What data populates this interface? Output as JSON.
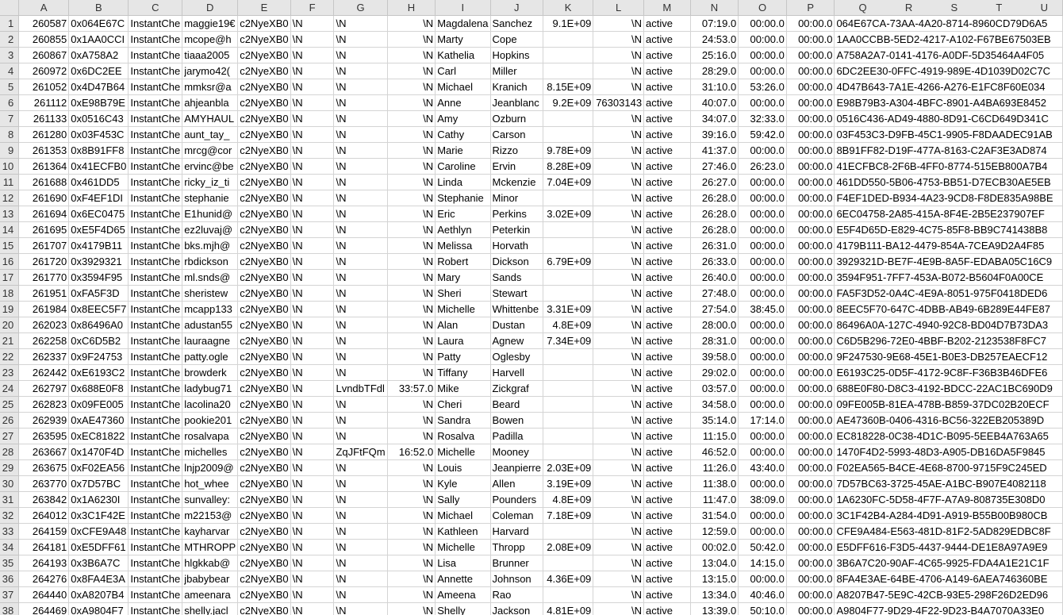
{
  "columns": [
    "A",
    "B",
    "C",
    "D",
    "E",
    "F",
    "G",
    "H",
    "I",
    "J",
    "K",
    "L",
    "M",
    "N",
    "O",
    "P",
    "Q",
    "R",
    "S",
    "T",
    "U"
  ],
  "rows": [
    [
      "260587",
      "0x064E67C",
      "InstantChe",
      "maggie19€",
      "c2NyeXB0",
      "\\N",
      "\\N",
      "\\N",
      "Magdalena",
      "Sanchez",
      "9.1E+09",
      "\\N",
      "active",
      "07:19.0",
      "00:00.0",
      "00:00.0",
      "064E67CA-73AA-4A20-8714-8960CD79D6A5"
    ],
    [
      "260855",
      "0x1AA0CCI",
      "InstantChe",
      "mcope@h",
      "c2NyeXB0",
      "\\N",
      "\\N",
      "\\N",
      "Marty",
      "Cope",
      "",
      "\\N",
      "active",
      "24:53.0",
      "00:00.0",
      "00:00.0",
      "1AA0CCBB-5ED2-4217-A102-F67BE67503EB"
    ],
    [
      "260867",
      "0xA758A2",
      "InstantChe",
      "tiaaa2005",
      "c2NyeXB0",
      "\\N",
      "\\N",
      "\\N",
      "Kathelia",
      "Hopkins",
      "",
      "\\N",
      "active",
      "25:16.0",
      "00:00.0",
      "00:00.0",
      "A758A2A7-0141-4176-A0DF-5D35464A4F05"
    ],
    [
      "260972",
      "0x6DC2EE",
      "InstantChe",
      "jarymo42(",
      "c2NyeXB0",
      "\\N",
      "\\N",
      "\\N",
      "Carl",
      "Miller",
      "",
      "\\N",
      "active",
      "28:29.0",
      "00:00.0",
      "00:00.0",
      "6DC2EE30-0FFC-4919-989E-4D1039D02C7C"
    ],
    [
      "261052",
      "0x4D47B64",
      "InstantChe",
      "mmksr@a",
      "c2NyeXB0",
      "\\N",
      "\\N",
      "\\N",
      "Michael",
      "Kranich",
      "8.15E+09",
      "\\N",
      "active",
      "31:10.0",
      "53:26.0",
      "00:00.0",
      "4D47B643-7A1E-4266-A276-E1FC8F60E034"
    ],
    [
      "261112",
      "0xE98B79E",
      "InstantChe",
      "ahjeanbla",
      "c2NyeXB0",
      "\\N",
      "\\N",
      "\\N",
      "Anne",
      "Jeanblanc",
      "9.2E+09",
      "76303143",
      "active",
      "40:07.0",
      "00:00.0",
      "00:00.0",
      "E98B79B3-A304-4BFC-8901-A4BA693E8452"
    ],
    [
      "261133",
      "0x0516C43",
      "InstantChe",
      "AMYHAUL",
      "c2NyeXB0",
      "\\N",
      "\\N",
      "\\N",
      "Amy",
      "Ozburn",
      "",
      "\\N",
      "active",
      "34:07.0",
      "32:33.0",
      "00:00.0",
      "0516C436-AD49-4880-8D91-C6CD649D341C"
    ],
    [
      "261280",
      "0x03F453C",
      "InstantChe",
      "aunt_tay_",
      "c2NyeXB0",
      "\\N",
      "\\N",
      "\\N",
      "Cathy",
      "Carson",
      "",
      "\\N",
      "active",
      "39:16.0",
      "59:42.0",
      "00:00.0",
      "03F453C3-D9FB-45C1-9905-F8DAADEC91AB"
    ],
    [
      "261353",
      "0x8B91FF8",
      "InstantChe",
      "mrcg@cor",
      "c2NyeXB0",
      "\\N",
      "\\N",
      "\\N",
      "Marie",
      "Rizzo",
      "9.78E+09",
      "\\N",
      "active",
      "41:37.0",
      "00:00.0",
      "00:00.0",
      "8B91FF82-D19F-477A-8163-C2AF3E3AD874"
    ],
    [
      "261364",
      "0x41ECFB0",
      "InstantChe",
      "ervinc@be",
      "c2NyeXB0",
      "\\N",
      "\\N",
      "\\N",
      "Caroline",
      "Ervin",
      "8.28E+09",
      "\\N",
      "active",
      "27:46.0",
      "26:23.0",
      "00:00.0",
      "41ECFBC8-2F6B-4FF0-8774-515EB800A7B4"
    ],
    [
      "261688",
      "0x461DD5",
      "InstantChe",
      "ricky_iz_ti",
      "c2NyeXB0",
      "\\N",
      "\\N",
      "\\N",
      "Linda",
      "Mckenzie",
      "7.04E+09",
      "\\N",
      "active",
      "26:27.0",
      "00:00.0",
      "00:00.0",
      "461DD550-5B06-4753-BB51-D7ECB30AE5EB"
    ],
    [
      "261690",
      "0xF4EF1DI",
      "InstantChe",
      "stephanie",
      "c2NyeXB0",
      "\\N",
      "\\N",
      "\\N",
      "Stephanie",
      "Minor",
      "",
      "\\N",
      "active",
      "26:28.0",
      "00:00.0",
      "00:00.0",
      "F4EF1DED-B934-4A23-9CD8-F8DE835A98BE"
    ],
    [
      "261694",
      "0x6EC0475",
      "InstantChe",
      "E1hunid@",
      "c2NyeXB0",
      "\\N",
      "\\N",
      "\\N",
      "Eric",
      "Perkins",
      "3.02E+09",
      "\\N",
      "active",
      "26:28.0",
      "00:00.0",
      "00:00.0",
      "6EC04758-2A85-415A-8F4E-2B5E237907EF"
    ],
    [
      "261695",
      "0xE5F4D65",
      "InstantChe",
      "ez2luvaj@",
      "c2NyeXB0",
      "\\N",
      "\\N",
      "\\N",
      "Aethlyn",
      "Peterkin",
      "",
      "\\N",
      "active",
      "26:28.0",
      "00:00.0",
      "00:00.0",
      "E5F4D65D-E829-4C75-85F8-BB9C741438B8"
    ],
    [
      "261707",
      "0x4179B11",
      "InstantChe",
      "bks.mjh@",
      "c2NyeXB0",
      "\\N",
      "\\N",
      "\\N",
      "Melissa",
      "Horvath",
      "",
      "\\N",
      "active",
      "26:31.0",
      "00:00.0",
      "00:00.0",
      "4179B111-BA12-4479-854A-7CEA9D2A4F85"
    ],
    [
      "261720",
      "0x3929321",
      "InstantChe",
      "rbdickson",
      "c2NyeXB0",
      "\\N",
      "\\N",
      "\\N",
      "Robert",
      "Dickson",
      "6.79E+09",
      "\\N",
      "active",
      "26:33.0",
      "00:00.0",
      "00:00.0",
      "3929321D-BE7F-4E9B-8A5F-EDABA05C16C9"
    ],
    [
      "261770",
      "0x3594F95",
      "InstantChe",
      "ml.snds@",
      "c2NyeXB0",
      "\\N",
      "\\N",
      "\\N",
      "Mary",
      "Sands",
      "",
      "\\N",
      "active",
      "26:40.0",
      "00:00.0",
      "00:00.0",
      "3594F951-7FF7-453A-B072-B5604F0A00CE"
    ],
    [
      "261951",
      "0xFA5F3D",
      "InstantChe",
      "sheristew",
      "c2NyeXB0",
      "\\N",
      "\\N",
      "\\N",
      "Sheri",
      "Stewart",
      "",
      "\\N",
      "active",
      "27:48.0",
      "00:00.0",
      "00:00.0",
      "FA5F3D52-0A4C-4E9A-8051-975F0418DED6"
    ],
    [
      "261984",
      "0x8EEC5F7",
      "InstantChe",
      "mcapp133",
      "c2NyeXB0",
      "\\N",
      "\\N",
      "\\N",
      "Michelle",
      "Whittenbe",
      "3.31E+09",
      "\\N",
      "active",
      "27:54.0",
      "38:45.0",
      "00:00.0",
      "8EEC5F70-647C-4DBB-AB49-6B289E44FE87"
    ],
    [
      "262023",
      "0x86496A0",
      "InstantChe",
      "adustan55",
      "c2NyeXB0",
      "\\N",
      "\\N",
      "\\N",
      "Alan",
      "Dustan",
      "4.8E+09",
      "\\N",
      "active",
      "28:00.0",
      "00:00.0",
      "00:00.0",
      "86496A0A-127C-4940-92C8-BD04D7B73DA3"
    ],
    [
      "262258",
      "0xC6D5B2",
      "InstantChe",
      "lauraagne",
      "c2NyeXB0",
      "\\N",
      "\\N",
      "\\N",
      "Laura",
      "Agnew",
      "7.34E+09",
      "\\N",
      "active",
      "28:31.0",
      "00:00.0",
      "00:00.0",
      "C6D5B296-72E0-4BBF-B202-2123538F8FC7"
    ],
    [
      "262337",
      "0x9F24753",
      "InstantChe",
      "patty.ogle",
      "c2NyeXB0",
      "\\N",
      "\\N",
      "\\N",
      "Patty",
      "Oglesby",
      "",
      "\\N",
      "active",
      "39:58.0",
      "00:00.0",
      "00:00.0",
      "9F247530-9E68-45E1-B0E3-DB257EAECF12"
    ],
    [
      "262442",
      "0xE6193C2",
      "InstantChe",
      "browderk",
      "c2NyeXB0",
      "\\N",
      "\\N",
      "\\N",
      "Tiffany",
      "Harvell",
      "",
      "\\N",
      "active",
      "29:02.0",
      "00:00.0",
      "00:00.0",
      "E6193C25-0D5F-4172-9C8F-F36B3B46DFE6"
    ],
    [
      "262797",
      "0x688E0F8",
      "InstantChe",
      "ladybug71",
      "c2NyeXB0",
      "\\N",
      "LvndbTFdl",
      "33:57.0",
      "Mike",
      "Zickgraf",
      "",
      "\\N",
      "active",
      "03:57.0",
      "00:00.0",
      "00:00.0",
      "688E0F80-D8C3-4192-BDCC-22AC1BC690D9"
    ],
    [
      "262823",
      "0x09FE005",
      "InstantChe",
      "lacolina20",
      "c2NyeXB0",
      "\\N",
      "\\N",
      "\\N",
      "Cheri",
      "Beard",
      "",
      "\\N",
      "active",
      "34:58.0",
      "00:00.0",
      "00:00.0",
      "09FE005B-81EA-478B-B859-37DC02B20ECF"
    ],
    [
      "262939",
      "0xAE47360",
      "InstantChe",
      "pookie201",
      "c2NyeXB0",
      "\\N",
      "\\N",
      "\\N",
      "Sandra",
      "Bowen",
      "",
      "\\N",
      "active",
      "35:14.0",
      "17:14.0",
      "00:00.0",
      "AE47360B-0406-4316-BC56-322EB205389D"
    ],
    [
      "263595",
      "0xEC81822",
      "InstantChe",
      "rosalvapa",
      "c2NyeXB0",
      "\\N",
      "\\N",
      "\\N",
      "Rosalva",
      "Padilla",
      "",
      "\\N",
      "active",
      "11:15.0",
      "00:00.0",
      "00:00.0",
      "EC818228-0C38-4D1C-B095-5EEB4A763A65"
    ],
    [
      "263667",
      "0x1470F4D",
      "InstantChe",
      "michelles",
      "c2NyeXB0",
      "\\N",
      "ZqJFtFQm",
      "16:52.0",
      "Michelle",
      "Mooney",
      "",
      "\\N",
      "active",
      "46:52.0",
      "00:00.0",
      "00:00.0",
      "1470F4D2-5993-48D3-A905-DB16DA5F9845"
    ],
    [
      "263675",
      "0xF02EA56",
      "InstantChe",
      "lnjp2009@",
      "c2NyeXB0",
      "\\N",
      "\\N",
      "\\N",
      "Louis",
      "Jeanpierre",
      "2.03E+09",
      "\\N",
      "active",
      "11:26.0",
      "43:40.0",
      "00:00.0",
      "F02EA565-B4CE-4E68-8700-9715F9C245ED"
    ],
    [
      "263770",
      "0x7D57BC",
      "InstantChe",
      "hot_whee",
      "c2NyeXB0",
      "\\N",
      "\\N",
      "\\N",
      "Kyle",
      "Allen",
      "3.19E+09",
      "\\N",
      "active",
      "11:38.0",
      "00:00.0",
      "00:00.0",
      "7D57BC63-3725-45AE-A1BC-B907E4082118"
    ],
    [
      "263842",
      "0x1A6230I",
      "InstantChe",
      "sunvalley:",
      "c2NyeXB0",
      "\\N",
      "\\N",
      "\\N",
      "Sally",
      "Pounders",
      "4.8E+09",
      "\\N",
      "active",
      "11:47.0",
      "38:09.0",
      "00:00.0",
      "1A6230FC-5D58-4F7F-A7A9-808735E308D0"
    ],
    [
      "264012",
      "0x3C1F42E",
      "InstantChe",
      "m22153@",
      "c2NyeXB0",
      "\\N",
      "\\N",
      "\\N",
      "Michael",
      "Coleman",
      "7.18E+09",
      "\\N",
      "active",
      "31:54.0",
      "00:00.0",
      "00:00.0",
      "3C1F42B4-A284-4D91-A919-B55B00B980CB"
    ],
    [
      "264159",
      "0xCFE9A48",
      "InstantChe",
      "kayharvar",
      "c2NyeXB0",
      "\\N",
      "\\N",
      "\\N",
      "Kathleen",
      "Harvard",
      "",
      "\\N",
      "active",
      "12:59.0",
      "00:00.0",
      "00:00.0",
      "CFE9A484-E563-481D-81F2-5AD829EDBC8F"
    ],
    [
      "264181",
      "0xE5DFF61",
      "InstantChe",
      "MTHROPP",
      "c2NyeXB0",
      "\\N",
      "\\N",
      "\\N",
      "Michelle",
      "Thropp",
      "2.08E+09",
      "\\N",
      "active",
      "00:02.0",
      "50:42.0",
      "00:00.0",
      "E5DFF616-F3D5-4437-9444-DE1E8A97A9E9"
    ],
    [
      "264193",
      "0x3B6A7C",
      "InstantChe",
      "hlgkkab@",
      "c2NyeXB0",
      "\\N",
      "\\N",
      "\\N",
      "Lisa",
      "Brunner",
      "",
      "\\N",
      "active",
      "13:04.0",
      "14:15.0",
      "00:00.0",
      "3B6A7C20-90AF-4C65-9925-FDA4A1E21C1F"
    ],
    [
      "264276",
      "0x8FA4E3A",
      "InstantChe",
      "jbabybear",
      "c2NyeXB0",
      "\\N",
      "\\N",
      "\\N",
      "Annette",
      "Johnson",
      "4.36E+09",
      "\\N",
      "active",
      "13:15.0",
      "00:00.0",
      "00:00.0",
      "8FA4E3AE-64BE-4706-A149-6AEA746360BE"
    ],
    [
      "264440",
      "0xA8207B4",
      "InstantChe",
      "ameenara",
      "c2NyeXB0",
      "\\N",
      "\\N",
      "\\N",
      "Ameena",
      "Rao",
      "",
      "\\N",
      "active",
      "13:34.0",
      "40:46.0",
      "00:00.0",
      "A8207B47-5E9C-42CB-93E5-298F26D2ED96"
    ],
    [
      "264469",
      "0xA9804F7",
      "InstantChe",
      "shelly.jacl",
      "c2NyeXB0",
      "\\N",
      "\\N",
      "\\N",
      "Shelly",
      "Jackson",
      "4.81E+09",
      "\\N",
      "active",
      "13:39.0",
      "50:10.0",
      "00:00.0",
      "A9804F77-9D29-4F22-9D23-B4A7070A33E0"
    ]
  ]
}
